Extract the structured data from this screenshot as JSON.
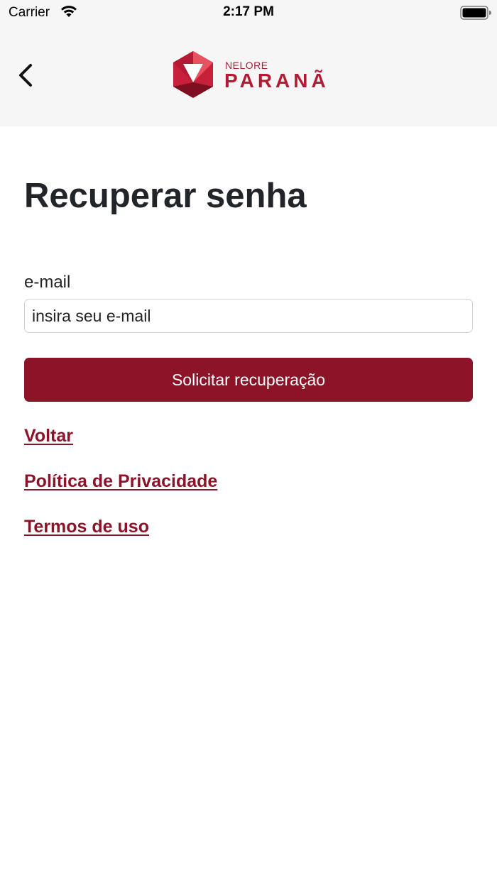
{
  "status_bar": {
    "carrier": "Carrier",
    "time": "2:17 PM"
  },
  "header": {
    "back_icon": "chevron-left-icon",
    "logo": {
      "top_text": "NELORE",
      "main_text": "PARANÃ",
      "colors": {
        "primary": "#b31b34",
        "light": "#e8515f",
        "dark": "#7e0f20"
      }
    }
  },
  "form": {
    "title": "Recuperar senha",
    "email_label": "e-mail",
    "email_placeholder": "insira seu e-mail",
    "email_value": "",
    "submit_label": "Solicitar recuperação"
  },
  "links": {
    "back": "Voltar",
    "privacy": "Política de Privacidade",
    "terms": "Termos de uso"
  },
  "theme": {
    "accent": "#8b1428",
    "header_bg": "#f6f6f6",
    "text": "#212529"
  }
}
